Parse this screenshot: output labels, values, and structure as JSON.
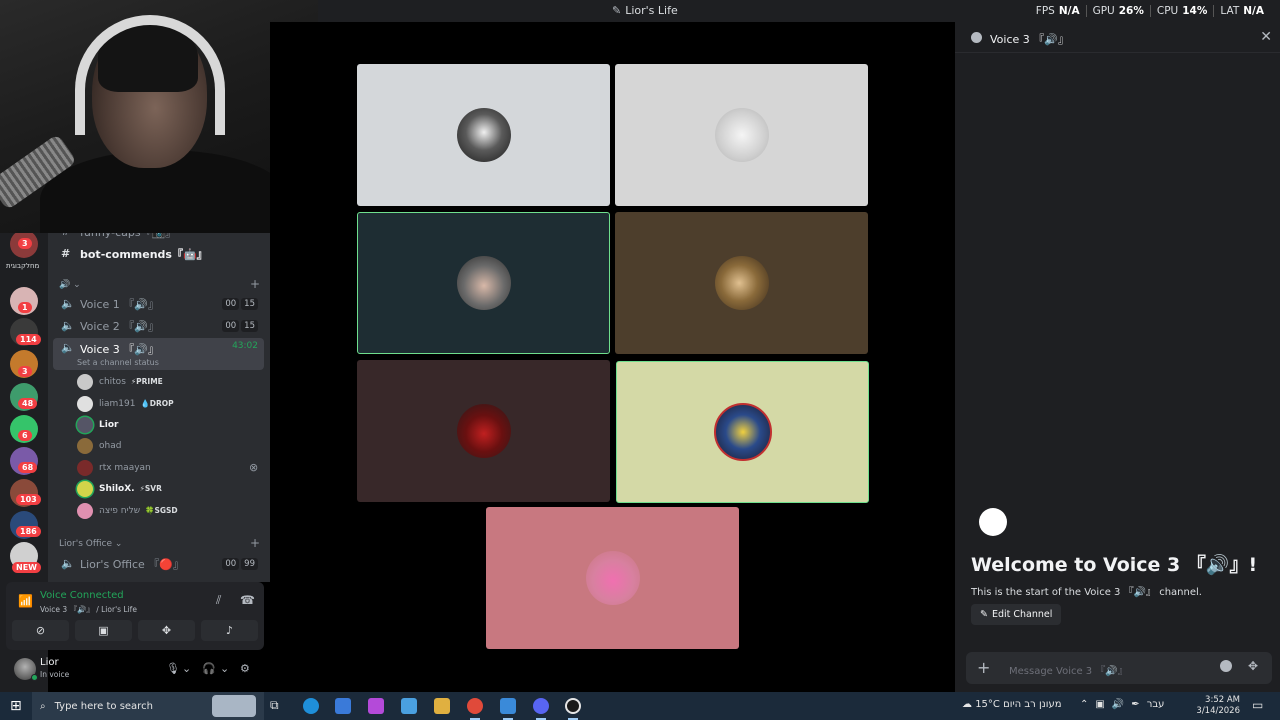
{
  "window": {
    "title": "Lior's Life",
    "stats": [
      {
        "label": "FPS",
        "value": "N/A"
      },
      {
        "label": "GPU",
        "value": "26%"
      },
      {
        "label": "CPU",
        "value": "14%"
      },
      {
        "label": "LAT",
        "value": "N/A"
      }
    ]
  },
  "servers": {
    "folder_label": "מחלקבוגית",
    "badges": [
      "3",
      "1",
      "114",
      "3",
      "48",
      "6",
      "68",
      "103",
      "186",
      "NEW"
    ]
  },
  "channels": {
    "funny_caps": "funny-caps『📸』",
    "bot_commends": "bot-commends『🤖』",
    "voice1": {
      "name": "Voice 1 『🔊』",
      "count_a": "00",
      "count_b": "15"
    },
    "voice2": {
      "name": "Voice 2 『🔊』",
      "count_a": "00",
      "count_b": "15"
    },
    "voice3": {
      "name": "Voice 3 『🔊』",
      "timer": "43:02",
      "status": "Set a channel status"
    },
    "category2": "Lior's Office",
    "office": {
      "name": "Lior's Office 『🔴』",
      "count_a": "00",
      "count_b": "99"
    }
  },
  "voice_users": [
    {
      "name": "chitos",
      "tag": "⚡PRIME"
    },
    {
      "name": "liam191",
      "tag": "💧DROP"
    },
    {
      "name": "Lior",
      "tag": ""
    },
    {
      "name": "ohad",
      "tag": ""
    },
    {
      "name": "rtx maayan",
      "tag": ""
    },
    {
      "name": "ShiloX.",
      "tag": "⚡SVR"
    },
    {
      "name": "שליח פיצה",
      "tag": "🍀SGSD"
    }
  ],
  "voice_panel": {
    "title": "Voice Connected",
    "subtitle": "Voice 3 『🔊』 / Lior's Life"
  },
  "user": {
    "name": "Lior",
    "state": "In voice"
  },
  "right_panel": {
    "channel": "Voice 3 『🔊』",
    "welcome_title": "Welcome to Voice 3 『🔊』!",
    "welcome_sub": "This is the start of the Voice 3 『🔊』 channel.",
    "edit_button": "Edit Channel",
    "message_placeholder": "Message Voice 3 『🔊』"
  },
  "taskbar": {
    "search_placeholder": "Type here to search",
    "weather": "15°C  מעונן רב היום",
    "lang": "עבר",
    "time": "3:52 AM",
    "date": "3/14/2026"
  },
  "colors": {
    "accent_green": "#23a55a",
    "speaking_border": "#6fdf8d",
    "badge_red": "#f23f43"
  }
}
